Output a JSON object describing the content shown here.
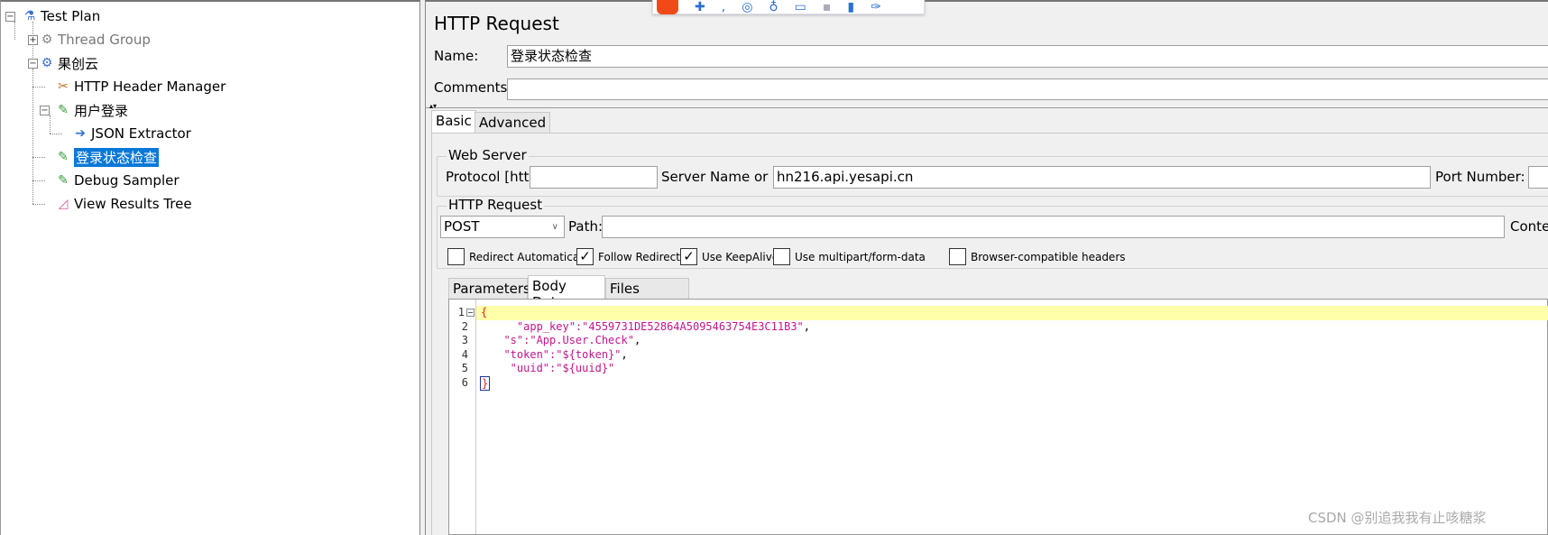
{
  "tree": {
    "items": [
      {
        "label": "Test Plan",
        "icon": "flask-icon"
      },
      {
        "label": "Thread Group",
        "icon": "gear-icon",
        "disabled": true
      },
      {
        "label": "果创云",
        "icon": "gear-icon"
      },
      {
        "label": "HTTP Header Manager",
        "icon": "tools-icon"
      },
      {
        "label": "用户登录",
        "icon": "pipette-icon"
      },
      {
        "label": "JSON Extractor",
        "icon": "extractor-icon"
      },
      {
        "label": "登录状态检查",
        "icon": "pipette-icon",
        "selected": true
      },
      {
        "label": "Debug Sampler",
        "icon": "pipette-icon"
      },
      {
        "label": "View Results Tree",
        "icon": "chart-icon"
      }
    ]
  },
  "panel": {
    "title": "HTTP Request",
    "name_label": "Name:",
    "name_value": "登录状态检查",
    "comments_label": "Comments:",
    "comments_value": "",
    "tabs": [
      "Basic",
      "Advanced"
    ],
    "web_server": {
      "legend": "Web Server",
      "protocol_label": "Protocol [http]:",
      "protocol_value": "",
      "server_label": "Server Name or IP:",
      "server_value": "hn216.api.yesapi.cn",
      "port_label": "Port Number:",
      "port_value": ""
    },
    "http_request": {
      "legend": "HTTP Request",
      "method": "POST",
      "path_label": "Path:",
      "path_value": "",
      "content_label": "Conte"
    },
    "checkboxes": [
      {
        "label": "Redirect Automatically",
        "checked": false
      },
      {
        "label": "Follow Redirects",
        "checked": true
      },
      {
        "label": "Use KeepAlive",
        "checked": true
      },
      {
        "label": "Use multipart/form-data",
        "checked": false
      },
      {
        "label": "Browser-compatible headers",
        "checked": false
      }
    ],
    "subtabs": [
      "Parameters",
      "Body Data",
      "Files Upload"
    ],
    "body_lines": [
      "1",
      "2",
      "3",
      "4",
      "5",
      "6"
    ]
  },
  "code": {
    "l1": "{",
    "l2k": "    \"app_key\":\"4559731DE52864A5095463754E3C11B3\"",
    "l3k": "  \"s\":\"App.User.Check\"",
    "l4k": "  \"token\":\"${token}\"",
    "l5k": "   \"uuid\":\"${uuid}\"",
    "l6": "}",
    "comma": ","
  },
  "watermark": "CSDN @别追我我有止咳糖浆",
  "colors": {
    "selection": "#0a78d7",
    "code_string": "#c0168c",
    "current_line": "#ffffaa"
  }
}
